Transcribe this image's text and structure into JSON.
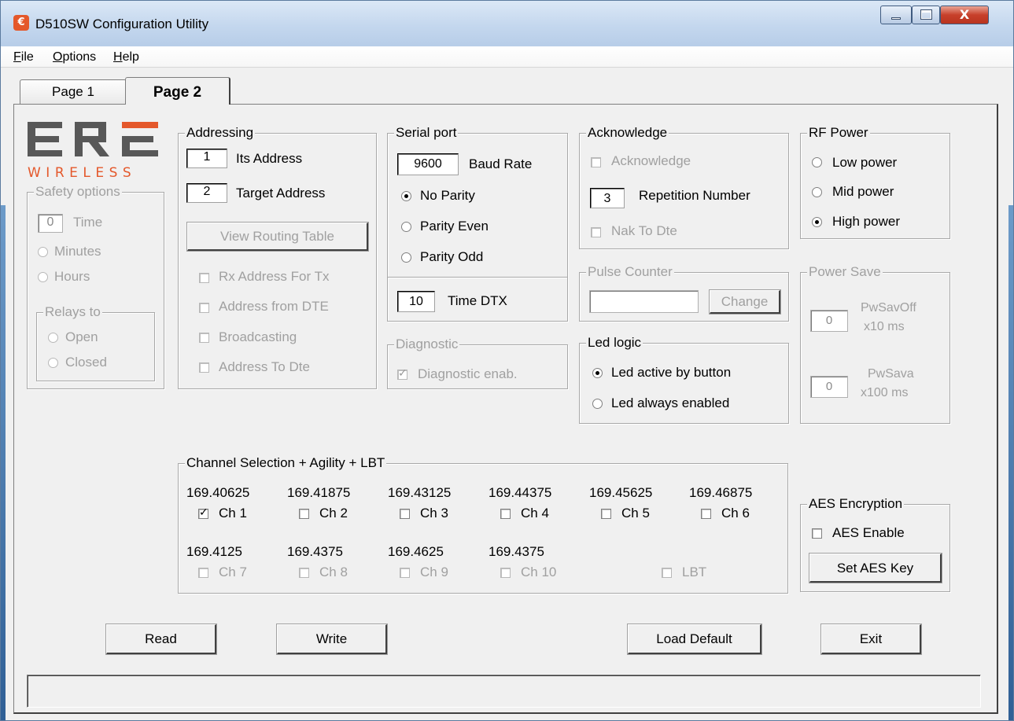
{
  "window": {
    "title": "D510SW  Configuration Utility",
    "close_glyph": "X"
  },
  "menu": {
    "file": "File",
    "options": "Options",
    "help": "Help"
  },
  "tabs": {
    "page1": "Page 1",
    "page2": "Page 2"
  },
  "logo": {
    "top": "ERE",
    "bottom": "WIRELESS",
    "accent_color": "#e4582b",
    "gray_color": "#585858"
  },
  "safety": {
    "title": "Safety options",
    "time_value": "0",
    "time_label": "Time",
    "minutes": "Minutes",
    "hours": "Hours",
    "relays_title": "Relays to",
    "open": "Open",
    "closed": "Closed"
  },
  "addressing": {
    "title": "Addressing",
    "its_address_value": "1",
    "its_address_label": "Its Address",
    "target_value": "2",
    "target_label": "Target Address",
    "routing_button": "View Routing Table",
    "rx_address": "Rx Address For Tx",
    "address_from_dte": "Address from DTE",
    "broadcasting": "Broadcasting",
    "address_to_dte": "Address To Dte"
  },
  "serial": {
    "title": "Serial port",
    "baud_value": "9600",
    "baud_label": "Baud Rate",
    "no_parity": "No Parity",
    "parity_even": "Parity Even",
    "parity_odd": "Parity Odd",
    "time_dtx_value": "10",
    "time_dtx_label": "Time DTX",
    "selected": "No Parity"
  },
  "diagnostic": {
    "title": "Diagnostic",
    "enab": "Diagnostic enab.",
    "checked": true
  },
  "acknowledge": {
    "title": "Acknowledge",
    "ack": "Acknowledge",
    "rep_value": "3",
    "rep_label": "Repetition Number",
    "nak": "Nak To Dte"
  },
  "pulse": {
    "title": "Pulse Counter",
    "value": "",
    "change": "Change"
  },
  "led": {
    "title": "Led logic",
    "by_button": "Led active by button",
    "always": "Led always enabled",
    "selected": "Led active by button"
  },
  "rf": {
    "title": "RF Power",
    "low": "Low power",
    "mid": "Mid power",
    "high": "High power",
    "selected": "High power"
  },
  "power_save": {
    "title": "Power Save",
    "off_value": "0",
    "off_label": "PwSavOff",
    "off_unit": "x10 ms",
    "sava_value": "0",
    "sava_label": "PwSava",
    "sava_unit": "x100 ms"
  },
  "channels": {
    "title": "Channel Selection + Agility + LBT",
    "row1": [
      {
        "freq": "169.40625",
        "label": "Ch 1",
        "checked": true
      },
      {
        "freq": "169.41875",
        "label": "Ch 2",
        "checked": false
      },
      {
        "freq": "169.43125",
        "label": "Ch 3",
        "checked": false
      },
      {
        "freq": "169.44375",
        "label": "Ch 4",
        "checked": false
      },
      {
        "freq": "169.45625",
        "label": "Ch 5",
        "checked": false
      },
      {
        "freq": "169.46875",
        "label": "Ch 6",
        "checked": false
      }
    ],
    "row2": [
      {
        "freq": "169.4125",
        "label": "Ch 7"
      },
      {
        "freq": "169.4375",
        "label": "Ch 8"
      },
      {
        "freq": "169.4625",
        "label": "Ch 9"
      },
      {
        "freq": "169.4375",
        "label": "Ch 10"
      }
    ],
    "lbt": "LBT"
  },
  "aes": {
    "title": "AES Encryption",
    "enable": "AES Enable",
    "set_key": "Set AES Key"
  },
  "buttons": {
    "read": "Read",
    "write": "Write",
    "load_default": "Load Default",
    "exit": "Exit"
  },
  "status": ""
}
